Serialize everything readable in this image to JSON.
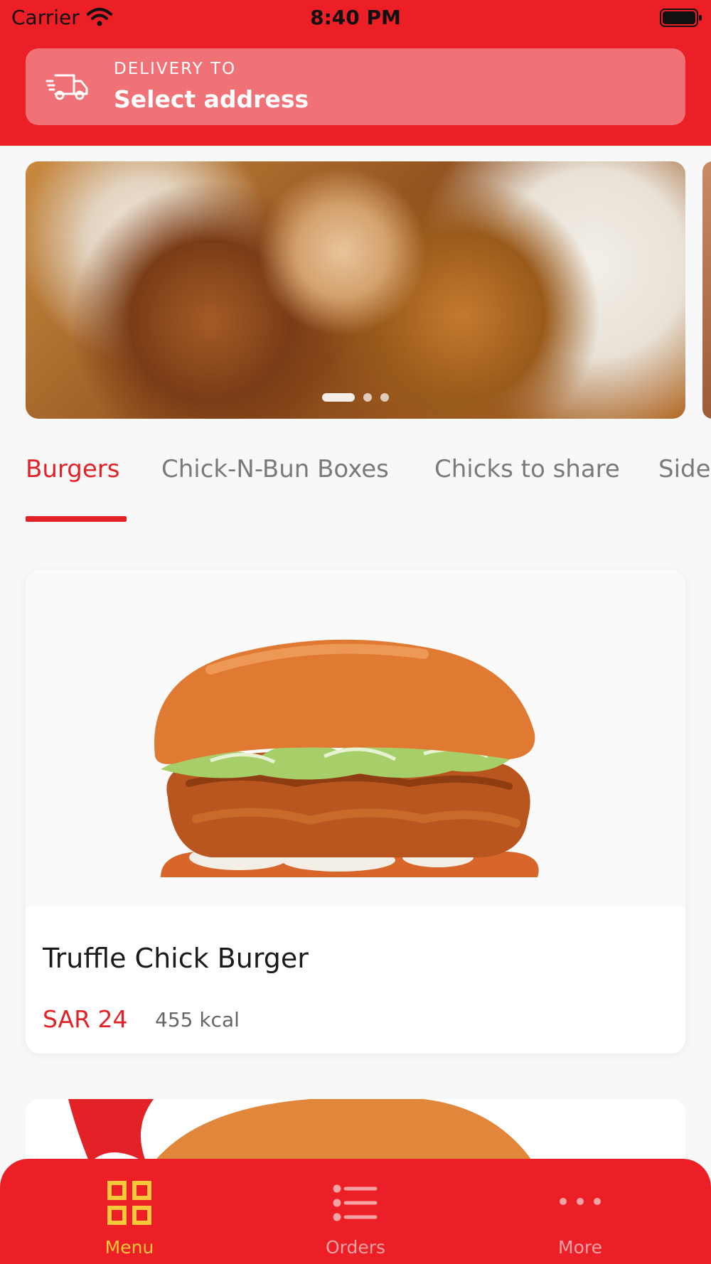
{
  "status_bar": {
    "carrier": "Carrier",
    "time": "8:40 PM"
  },
  "delivery": {
    "label": "DELIVERY TO",
    "value": "Select address"
  },
  "carousel": {
    "page_count": 3,
    "active_index": 0
  },
  "tabs": [
    {
      "label": "Burgers",
      "active": true
    },
    {
      "label": "Chick-N-Bun Boxes",
      "active": false
    },
    {
      "label": "Chicks to share",
      "active": false
    },
    {
      "label": "Sides",
      "active": false
    }
  ],
  "menu_items": [
    {
      "name": "Truffle Chick Burger",
      "price": "SAR 24",
      "kcal": "455 kcal"
    }
  ],
  "bottom_nav": [
    {
      "label": "Menu",
      "icon": "grid-icon",
      "active": true
    },
    {
      "label": "Orders",
      "icon": "list-icon",
      "active": false
    },
    {
      "label": "More",
      "icon": "more-dots-icon",
      "active": false
    }
  ],
  "colors": {
    "brand_red": "#ec1f26",
    "accent_red": "#e32227",
    "nav_active": "#f6c83a",
    "nav_inactive": "#f6a3a6"
  }
}
